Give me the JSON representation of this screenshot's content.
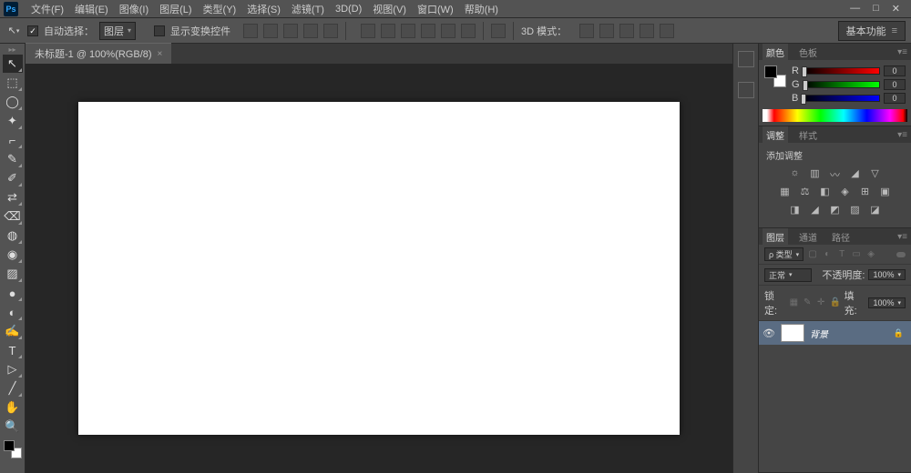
{
  "menu": {
    "items": [
      "文件(F)",
      "编辑(E)",
      "图像(I)",
      "图层(L)",
      "类型(Y)",
      "选择(S)",
      "滤镜(T)",
      "3D(D)",
      "视图(V)",
      "窗口(W)",
      "帮助(H)"
    ]
  },
  "optbar": {
    "auto_select": "自动选择：",
    "auto_select_value": "图层",
    "show_transform": "显示变换控件",
    "mode_3d": "3D 模式：",
    "workspace": "基本功能"
  },
  "doc": {
    "tab": "未标题-1 @ 100%(RGB/8)"
  },
  "tools": {
    "items": [
      "↖",
      "⬚",
      "◯",
      "✦",
      "⌐",
      "✎",
      "✐",
      "⇄",
      "⌫",
      "◍",
      "◉",
      "▨",
      "●",
      "◐",
      "✍",
      "T",
      "▷",
      "╱",
      "✋",
      "🔍"
    ]
  },
  "panels": {
    "color": {
      "tab_color": "颜色",
      "tab_swatches": "色板",
      "r": "R",
      "g": "G",
      "b": "B",
      "r_val": "0",
      "g_val": "0",
      "b_val": "0"
    },
    "adjust": {
      "tab_adjust": "调整",
      "tab_styles": "样式",
      "label": "添加调整"
    },
    "layers": {
      "tab_layers": "图层",
      "tab_channels": "通道",
      "tab_paths": "路径",
      "kind": "ρ 类型",
      "blend": "正常",
      "opacity_label": "不透明度:",
      "opacity_val": "100%",
      "lock_label": "锁定:",
      "fill_label": "填充:",
      "fill_val": "100%",
      "layer_name": "背景"
    }
  }
}
